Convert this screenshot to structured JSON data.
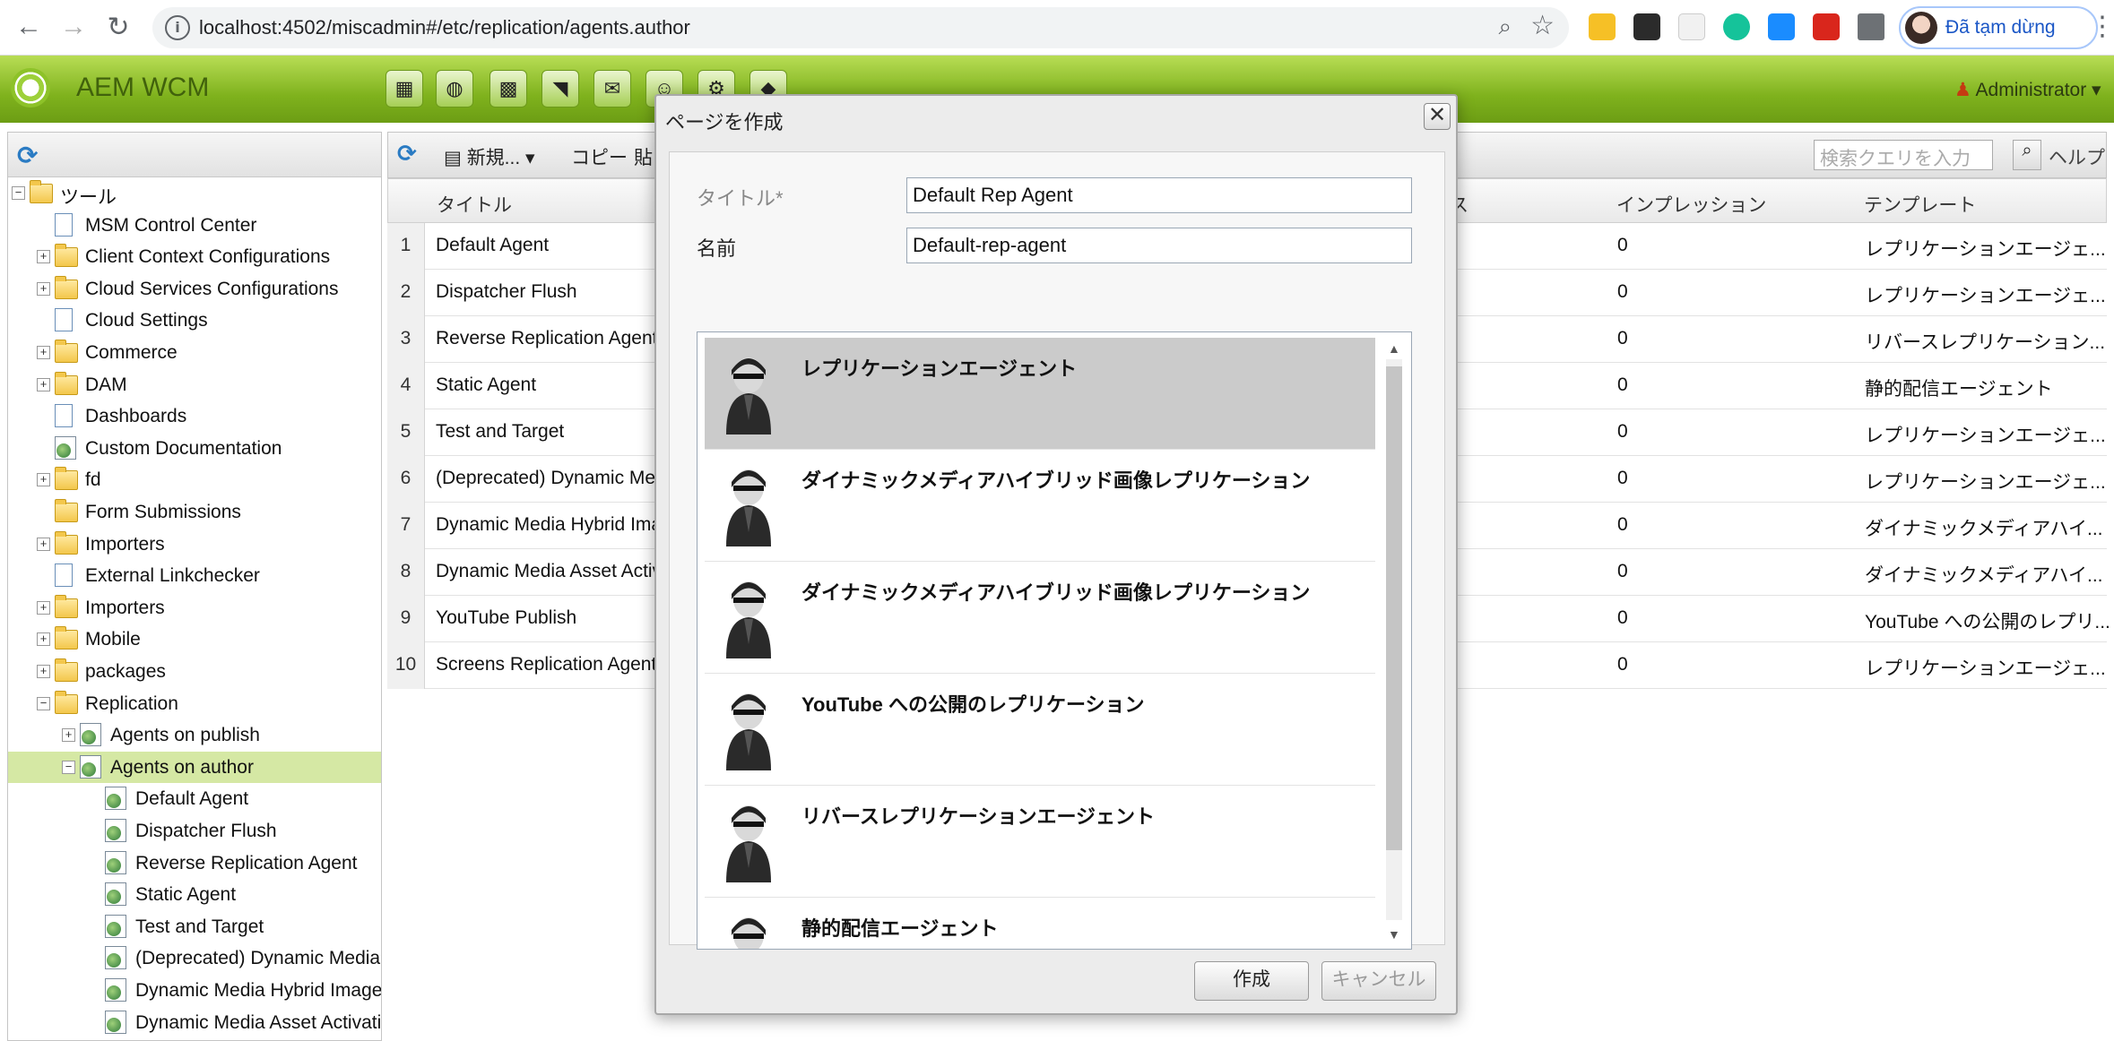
{
  "browser": {
    "url": "localhost:4502/miscadmin#/etc/replication/agents.author",
    "profile_label": "Đã tạm dừng"
  },
  "aem": {
    "title": "AEM WCM",
    "user": "Administrator"
  },
  "tree": {
    "items": [
      {
        "label": "ツール",
        "level": 0,
        "icon": "folder",
        "expander": "minus"
      },
      {
        "label": "MSM Control Center",
        "level": 1,
        "icon": "page",
        "expander": ""
      },
      {
        "label": "Client Context Configurations",
        "level": 1,
        "icon": "folder",
        "expander": "plus"
      },
      {
        "label": "Cloud Services Configurations",
        "level": 1,
        "icon": "folder",
        "expander": "plus"
      },
      {
        "label": "Cloud Settings",
        "level": 1,
        "icon": "page",
        "expander": ""
      },
      {
        "label": "Commerce",
        "level": 1,
        "icon": "folder",
        "expander": "plus"
      },
      {
        "label": "DAM",
        "level": 1,
        "icon": "folder",
        "expander": "plus"
      },
      {
        "label": "Dashboards",
        "level": 1,
        "icon": "page",
        "expander": ""
      },
      {
        "label": "Custom Documentation",
        "level": 1,
        "icon": "agent",
        "expander": ""
      },
      {
        "label": "fd",
        "level": 1,
        "icon": "folder",
        "expander": "plus"
      },
      {
        "label": "Form Submissions",
        "level": 1,
        "icon": "folder",
        "expander": ""
      },
      {
        "label": "Importers",
        "level": 1,
        "icon": "folder",
        "expander": "plus"
      },
      {
        "label": "External Linkchecker",
        "level": 1,
        "icon": "page",
        "expander": ""
      },
      {
        "label": "Importers",
        "level": 1,
        "icon": "folder",
        "expander": "plus"
      },
      {
        "label": "Mobile",
        "level": 1,
        "icon": "folder",
        "expander": "plus"
      },
      {
        "label": "packages",
        "level": 1,
        "icon": "folder",
        "expander": "plus"
      },
      {
        "label": "Replication",
        "level": 1,
        "icon": "folder",
        "expander": "minus"
      },
      {
        "label": "Agents on publish",
        "level": 2,
        "icon": "agent",
        "expander": "plus"
      },
      {
        "label": "Agents on author",
        "level": 2,
        "icon": "agent",
        "expander": "minus",
        "selected": true
      },
      {
        "label": "Default Agent",
        "level": 3,
        "icon": "agent",
        "expander": ""
      },
      {
        "label": "Dispatcher Flush",
        "level": 3,
        "icon": "agent",
        "expander": ""
      },
      {
        "label": "Reverse Replication Agent",
        "level": 3,
        "icon": "agent",
        "expander": ""
      },
      {
        "label": "Static Agent",
        "level": 3,
        "icon": "agent",
        "expander": ""
      },
      {
        "label": "Test and Target",
        "level": 3,
        "icon": "agent",
        "expander": ""
      },
      {
        "label": "(Deprecated) Dynamic Media Ag",
        "level": 3,
        "icon": "agent",
        "expander": ""
      },
      {
        "label": "Dynamic Media Hybrid Image Re",
        "level": 3,
        "icon": "agent",
        "expander": ""
      },
      {
        "label": "Dynamic Media Asset Activation",
        "level": 3,
        "icon": "agent",
        "expander": ""
      }
    ]
  },
  "toolbar": {
    "new_label": "新規...",
    "copy_label": "コピー",
    "paste_label": "貼",
    "search_placeholder": "検索クエリを入力",
    "help_label": "ヘルプ"
  },
  "grid": {
    "headers": {
      "title": "タイトル",
      "status": "ス",
      "impressions": "インプレッション",
      "template": "テンプレート"
    },
    "rows": [
      {
        "num": "1",
        "title": "Default Agent",
        "impressions": "0",
        "template": "レプリケーションエージェ..."
      },
      {
        "num": "2",
        "title": "Dispatcher Flush",
        "impressions": "0",
        "template": "レプリケーションエージェ..."
      },
      {
        "num": "3",
        "title": "Reverse Replication Agent",
        "impressions": "0",
        "template": "リバースレプリケーション..."
      },
      {
        "num": "4",
        "title": "Static Agent",
        "impressions": "0",
        "template": "静的配信エージェント"
      },
      {
        "num": "5",
        "title": "Test and Target",
        "impressions": "0",
        "template": "レプリケーションエージェ..."
      },
      {
        "num": "6",
        "title": "(Deprecated) Dynamic Media",
        "impressions": "0",
        "template": "レプリケーションエージェ..."
      },
      {
        "num": "7",
        "title": "Dynamic Media Hybrid Imag...",
        "impressions": "0",
        "template": "ダイナミックメディアハイ..."
      },
      {
        "num": "8",
        "title": "Dynamic Media Asset Activat",
        "impressions": "0",
        "template": "ダイナミックメディアハイ..."
      },
      {
        "num": "9",
        "title": "YouTube Publish",
        "impressions": "0",
        "template": "YouTube への公開のレプリ..."
      },
      {
        "num": "10",
        "title": "Screens Replication Agent",
        "impressions": "0",
        "template": "レプリケーションエージェ..."
      }
    ]
  },
  "dialog": {
    "title": "ページを作成",
    "title_label": "タイトル*",
    "title_value": "Default Rep Agent",
    "name_label": "名前",
    "name_value": "Default-rep-agent",
    "templates": [
      {
        "label": "レプリケーションエージェント",
        "selected": true
      },
      {
        "label": "ダイナミックメディアハイブリッド画像レプリケーション"
      },
      {
        "label": "ダイナミックメディアハイブリッド画像レプリケーション"
      },
      {
        "label": "YouTube への公開のレプリケーション"
      },
      {
        "label": "リバースレプリケーションエージェント"
      },
      {
        "label": "静的配信エージェント"
      }
    ],
    "create_label": "作成",
    "cancel_label": "キャンセル"
  }
}
